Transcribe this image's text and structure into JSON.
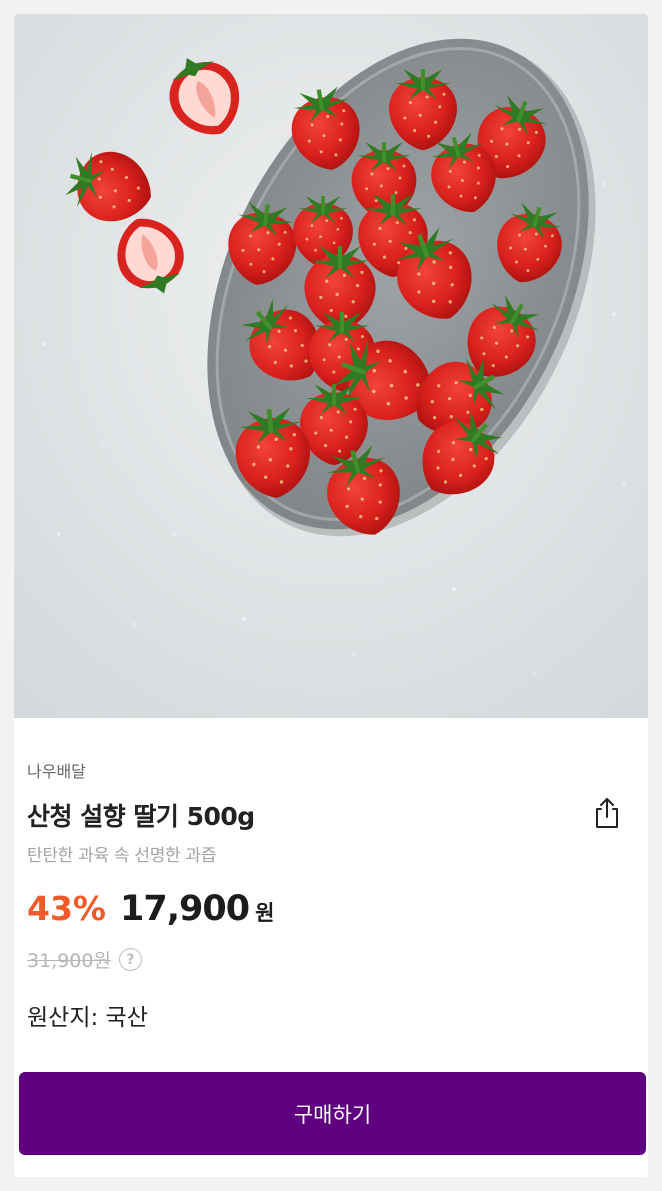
{
  "product": {
    "seller": "나우배달",
    "title": "산청 설향 딸기 500g",
    "subtitle": "탄탄한 과육 속 선명한 과즙",
    "discount": "43%",
    "price": "17,900",
    "currency": "원",
    "original_price": "31,900원",
    "origin": "원산지: 국산"
  },
  "icons": {
    "share": "share-icon",
    "help": "question-mark-icon",
    "help_glyph": "?"
  },
  "buy_button": {
    "label": "구매하기"
  },
  "colors": {
    "brand": "#5f0080",
    "discount": "#f05a28"
  }
}
